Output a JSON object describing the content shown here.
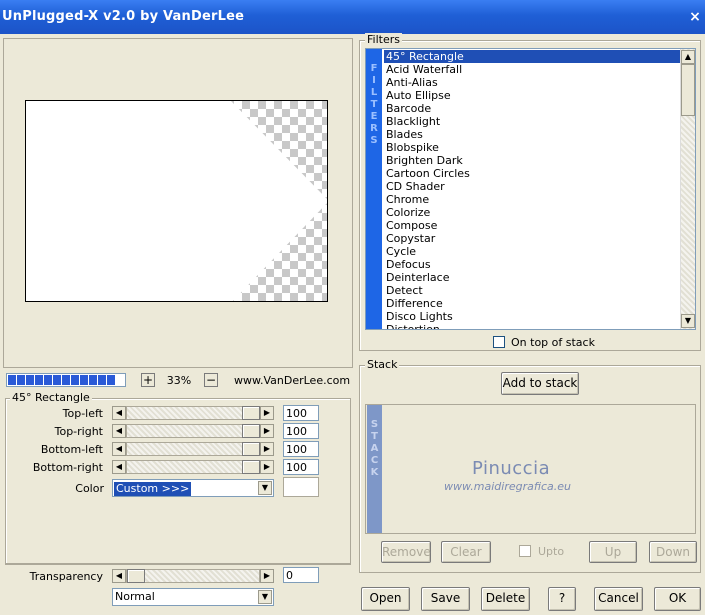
{
  "window": {
    "title": "UnPlugged-X v2.0 by VanDerLee",
    "close_glyph": "×"
  },
  "preview": {
    "zoom": "33%",
    "zoom_in": "+",
    "zoom_out": "−",
    "site": "www.VanDerLee.com"
  },
  "parameters": {
    "group_title": "45° Rectangle",
    "rows": [
      {
        "label": "Top-left",
        "value": "100"
      },
      {
        "label": "Top-right",
        "value": "100"
      },
      {
        "label": "Bottom-left",
        "value": "100"
      },
      {
        "label": "Bottom-right",
        "value": "100"
      }
    ],
    "color_label": "Color",
    "color_value": "Custom >>>",
    "transparency_label": "Transparency",
    "transparency_value": "0",
    "blend_mode": "Normal"
  },
  "filters": {
    "group_title": "Filters",
    "side_label": "FILTERS",
    "selected_index": 0,
    "items": [
      "45° Rectangle",
      "Acid Waterfall",
      "Anti-Alias",
      "Auto Ellipse",
      "Barcode",
      "Blacklight",
      "Blades",
      "Blobspike",
      "Brighten Dark",
      "Cartoon Circles",
      "CD Shader",
      "Chrome",
      "Colorize",
      "Compose",
      "Copystar",
      "Cycle",
      "Defocus",
      "Deinterlace",
      "Detect",
      "Difference",
      "Disco Lights",
      "Distortion"
    ],
    "on_top_label": "On top of stack"
  },
  "stack": {
    "group_title": "Stack",
    "add_label": "Add to stack",
    "side_label": "STACK",
    "watermark_title": "Pinuccia",
    "watermark_url": "www.maidiregrafica.eu",
    "buttons": {
      "remove": "Remove",
      "clear": "Clear",
      "upto": "Upto",
      "up": "Up",
      "down": "Down"
    }
  },
  "footer": {
    "open": "Open",
    "save": "Save",
    "delete": "Delete",
    "help": "?",
    "cancel": "Cancel",
    "ok": "OK"
  },
  "colors": {
    "title_blue": "#1f5fd6",
    "selection": "#1f4fb5",
    "face": "#ece9d8"
  }
}
